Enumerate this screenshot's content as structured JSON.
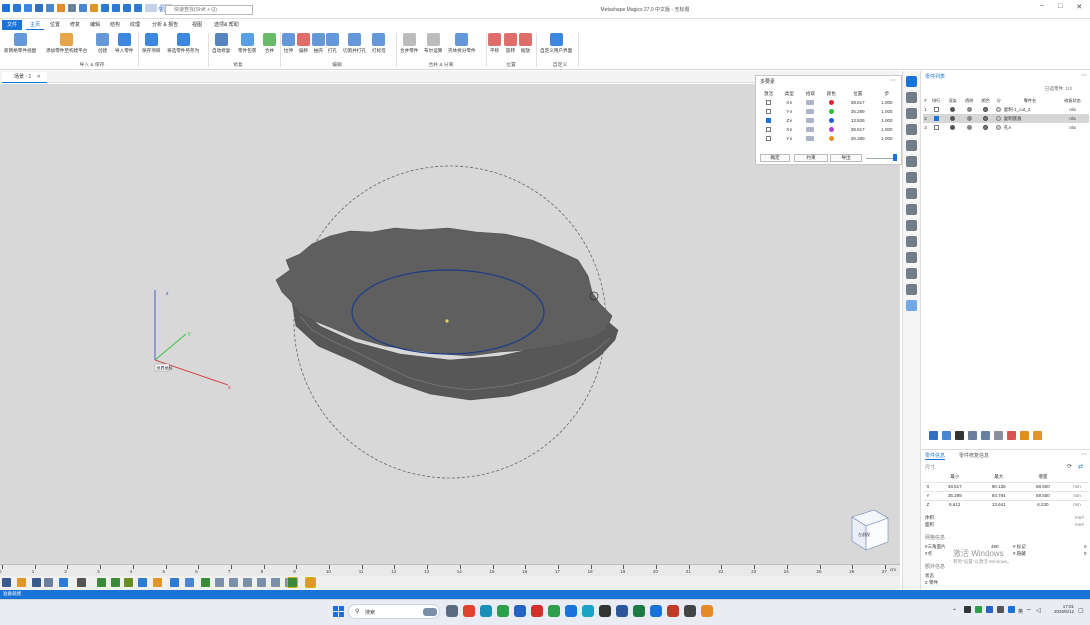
{
  "titlebar": {
    "app_title": "Metashape Magics 27.0 中文版 - 无标题",
    "search_placeholder": "快速查找(Shift + Q)",
    "controls": [
      "−",
      "□",
      "✕"
    ]
  },
  "menu": {
    "tabs": [
      "文件",
      "主页",
      "位置",
      "修复",
      "编辑",
      "结构",
      "纹理",
      "分析 & 报告",
      "视图",
      "选项& 帮助"
    ],
    "active_index": 1
  },
  "ribbon": {
    "buttons": [
      {
        "label": "新网格零件视图",
        "name": "new-mesh-part-view-button",
        "color": "#4a86d1"
      },
      {
        "label": "添加零件至构建平台",
        "name": "add-part-to-platform-button",
        "color": "#e0962b"
      },
      {
        "label": "创建",
        "name": "create-button",
        "color": "#4a86d1"
      },
      {
        "label": "导入零件",
        "name": "import-part-button",
        "color": "#1a73d9"
      },
      {
        "label": "保存项目",
        "name": "save-project-button",
        "color": "#1a73d9"
      },
      {
        "label": "将选零件另存为",
        "name": "save-selected-part-as-button",
        "color": "#1a73d9"
      },
      {
        "label": "自动修复",
        "name": "auto-fix-button",
        "color": "#3a6fb5"
      },
      {
        "label": "零件包裹",
        "name": "part-wrap-button",
        "color": "#3b8ede"
      },
      {
        "label": "合并",
        "name": "merge-button",
        "color": "#4cae4c"
      },
      {
        "label": "拉伸",
        "name": "extrude-button",
        "color": "#4a86d1"
      },
      {
        "label": "偏移",
        "name": "offset-button",
        "color": "#d9534f"
      },
      {
        "label": "抽壳",
        "name": "hollow-button",
        "color": "#4a86d1"
      },
      {
        "label": "打孔",
        "name": "punch-button",
        "color": "#4a86d1"
      },
      {
        "label": "切割并打孔",
        "name": "cut-and-punch-button",
        "color": "#4a86d1"
      },
      {
        "label": "打标签",
        "name": "label-button",
        "color": "#4a86d1"
      },
      {
        "label": "合并零件",
        "name": "merge-parts-button",
        "color": "#b0b0b0"
      },
      {
        "label": "布尔运算",
        "name": "boolean-button",
        "color": "#b0b0b0"
      },
      {
        "label": "壳体拆分零件",
        "name": "shell-split-part-button",
        "color": "#4a86d1"
      },
      {
        "label": "平移",
        "name": "translate-button",
        "color": "#d9534f"
      },
      {
        "label": "旋转",
        "name": "rotate-button",
        "color": "#d9534f"
      },
      {
        "label": "缩放",
        "name": "scale-button",
        "color": "#d9534f"
      },
      {
        "label": "自定义用户界面",
        "name": "customize-ui-button",
        "color": "#1a73d9"
      }
    ],
    "groups": [
      "导入 & 保存",
      "修复",
      "编辑",
      "合并 & 分离",
      "位置",
      "自定义"
    ]
  },
  "document": {
    "tab_label": "场景 - 1",
    "coordinate_label": "世界坐标"
  },
  "multi_panel": {
    "title": "多要素",
    "headers": [
      "激活",
      "类型",
      "拾取",
      "颜色",
      "位置",
      "步"
    ],
    "rows": [
      {
        "active": false,
        "type": "X∨",
        "color": "#e5222f",
        "position": "38.617",
        "step": "1.000"
      },
      {
        "active": false,
        "type": "Y∨",
        "color": "#2fbf3a",
        "position": "35.289",
        "step": "1.000"
      },
      {
        "active": true,
        "type": "Z∨",
        "color": "#1f5fd4",
        "position": "13.826",
        "step": "1.000"
      },
      {
        "active": false,
        "type": "X∨",
        "color": "#b43fd6",
        "position": "38.617",
        "step": "1.000"
      },
      {
        "active": false,
        "type": "Y∨",
        "color": "#f08c1e",
        "position": "35.289",
        "step": "1.000"
      }
    ],
    "buttons": [
      "确定",
      "约束",
      "导出"
    ]
  },
  "parts_panel": {
    "title": "零件列表",
    "selection_info": "已选零件: 1/3",
    "headers": [
      "#",
      "排行",
      "渲染",
      "透明",
      "颜色",
      "分",
      "零件名",
      "修复状态"
    ],
    "rows": [
      {
        "index": "1",
        "name": "复制-1_cut_2",
        "status": "n/a",
        "selected": false
      },
      {
        "index": "2",
        "name": "复制底板",
        "status": "n/a",
        "selected": true
      },
      {
        "index": "3",
        "name": "孔A",
        "status": "n/a",
        "selected": false
      }
    ]
  },
  "info_panel": {
    "tabs": [
      "零件信息",
      "零件修复信息"
    ],
    "section_size": "尺寸",
    "columns": [
      "最小",
      "最大",
      "增量"
    ],
    "rows": [
      {
        "axis": "X",
        "min": "38.617",
        "max": "90.138",
        "delta": "58.500",
        "unit": "mm"
      },
      {
        "axis": "Y",
        "min": "35.289",
        "max": "84.784",
        "delta": "59.500",
        "unit": "mm"
      },
      {
        "axis": "Z",
        "min": "6.612",
        "max": "13.641",
        "delta": "6.230",
        "unit": "mm"
      }
    ],
    "volume_label": "体积",
    "area_label": "面积",
    "volume_unit": "mm³",
    "area_unit": "mm²",
    "mesh_section": "网格信息",
    "triangle_label": "#三角面片",
    "triangle_value": "480",
    "points_label": "#点",
    "marked_label": "# 标记",
    "hidden_label": "# 隐藏",
    "marked_value": "0",
    "hidden_value": "0",
    "part_section": "额外信息",
    "status_label": "状态",
    "parts_label": "Σ 零件",
    "watermark_line1": "激活 Windows",
    "watermark_line2": "转到\"设置\"以激活 Windows。"
  },
  "ruler": {
    "ticks": [
      "0",
      "1",
      "2",
      "3",
      "4",
      "5",
      "6",
      "7",
      "8",
      "9",
      "10",
      "11",
      "12",
      "13",
      "14",
      "15",
      "16",
      "17",
      "18",
      "19",
      "20",
      "21",
      "22",
      "23",
      "24",
      "25",
      "26",
      "27"
    ],
    "unit": "cm"
  },
  "status_bar": {
    "text": "准备就绪"
  },
  "taskbar": {
    "search_label": "搜索",
    "lang": "英",
    "time": "17:01",
    "date": "2025/5/12"
  },
  "view_cube": {
    "label": "左前视"
  }
}
